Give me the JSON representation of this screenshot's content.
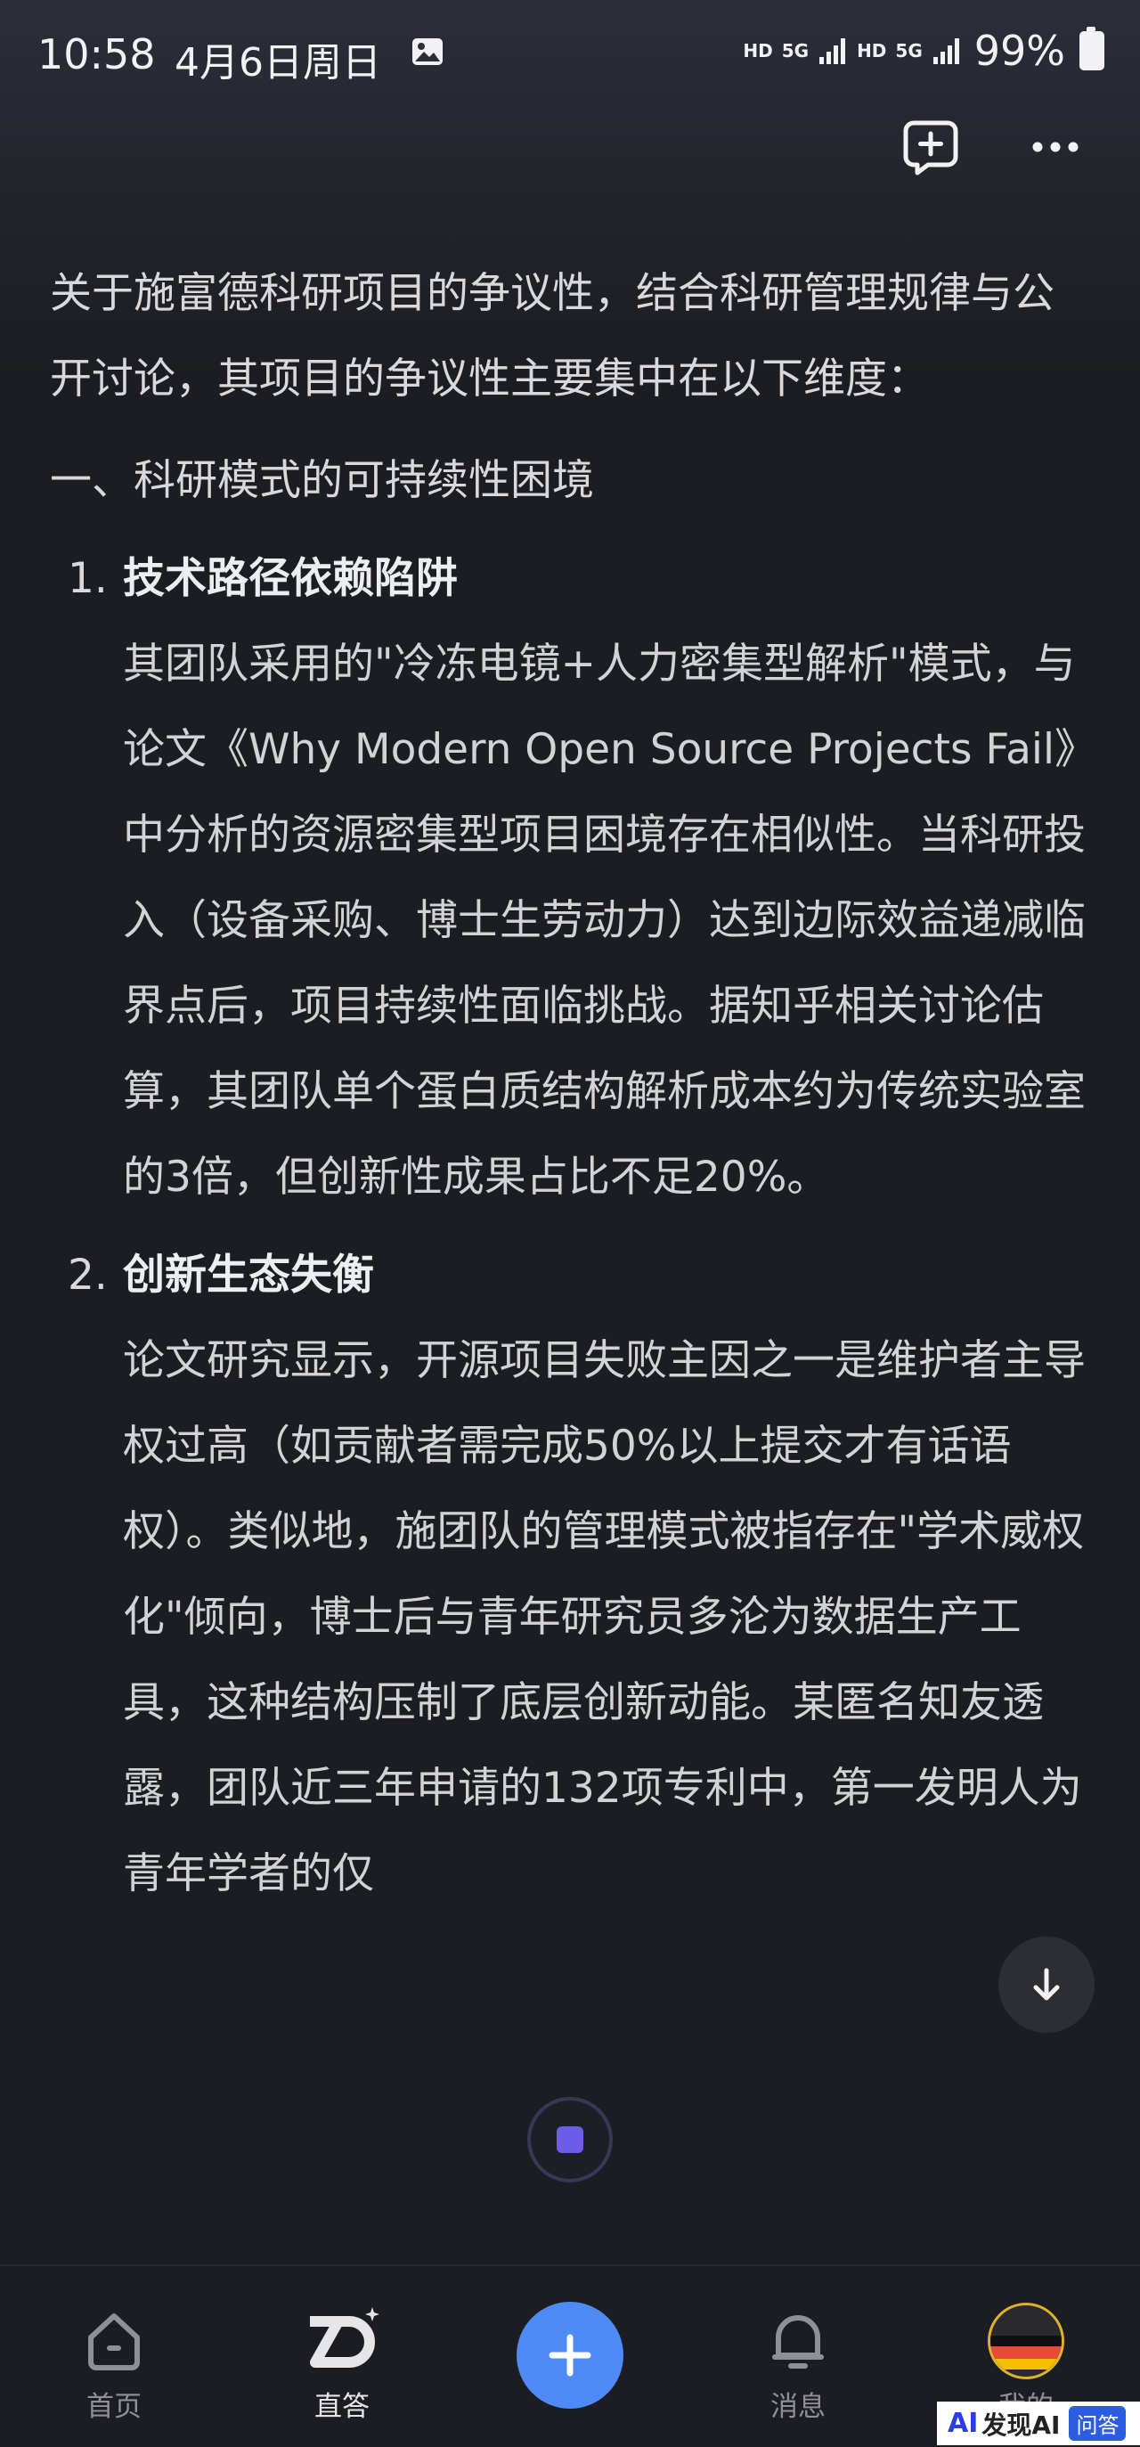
{
  "status_bar": {
    "time": "10:58",
    "date": "4月6日周日",
    "network_1": "HD",
    "net_5g_1": "5G",
    "network_2": "HD",
    "net_5g_2": "5G",
    "battery": "99%"
  },
  "top_actions": {
    "new_chat_icon": "chat-plus-icon",
    "more_icon": "more-horizontal-icon"
  },
  "content": {
    "intro": "关于施富德科研项目的争议性，结合科研管理规律与公开讨论，其项目的争议性主要集中在以下维度：",
    "section_1_title": "一、科研模式的可持续性困境",
    "items": [
      {
        "num": "1.",
        "title": "技术路径依赖陷阱",
        "body": "其团队采用的\"冷冻电镜+人力密集型解析\"模式，与论文《Why Modern Open Source Projects Fail》中分析的资源密集型项目困境存在相似性。当科研投入（设备采购、博士生劳动力）达到边际效益递减临界点后，项目持续性面临挑战。据知乎相关讨论估算，其团队单个蛋白质结构解析成本约为传统实验室的3倍，但创新性成果占比不足20%。"
      },
      {
        "num": "2.",
        "title": "创新生态失衡",
        "body": "论文研究显示，开源项目失败主因之一是维护者主导权过高（如贡献者需完成50%以上提交才有话语权）。类似地，施团队的管理模式被指存在\"学术威权化\"倾向，博士后与青年研究员多沦为数据生产工具，这种结构压制了底层创新动能。某匿名知友透露，团队近三年申请的132项专利中，第一发明人为青年学者的仅"
      }
    ]
  },
  "bottom_nav": {
    "items": [
      {
        "label": "首页",
        "icon": "home-icon"
      },
      {
        "label": "直答",
        "icon": "zhida-logo-icon"
      },
      {
        "label": "消息",
        "icon": "bell-icon"
      },
      {
        "label": "我的",
        "icon": "avatar"
      }
    ],
    "add_icon": "plus-icon"
  },
  "watermark": {
    "ai": "AI",
    "main": "发现AI",
    "tag": "问答"
  },
  "colors": {
    "background": "#1c1d22",
    "accent_blue": "#4e8bf5",
    "stop_purple": "#6c5ce7"
  }
}
